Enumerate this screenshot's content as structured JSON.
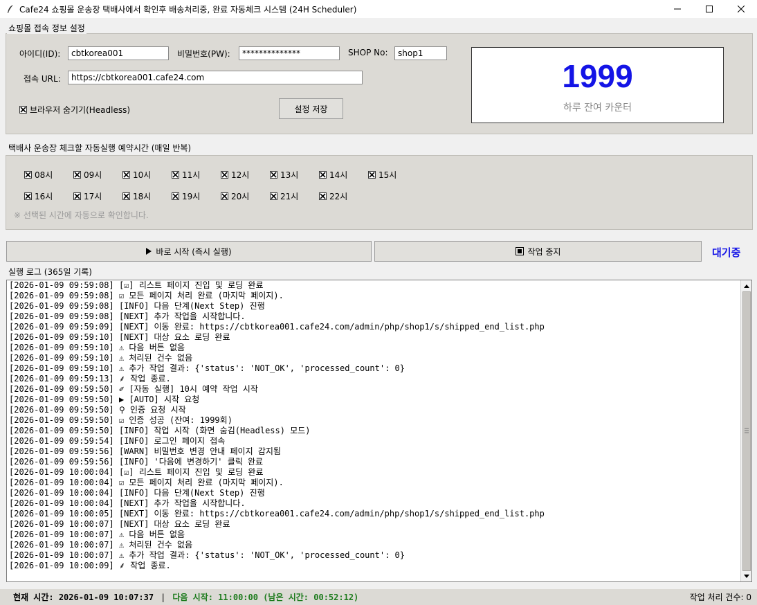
{
  "window": {
    "title": "Cafe24 쇼핑몰 운송장 택배사에서 확인후 배송처리중, 완료 자동체크 시스템 (24H Scheduler)"
  },
  "settings": {
    "group_label": "쇼핑몰 접속 정보 설정",
    "id_label": "아이디(ID):",
    "id_value": "cbtkorea001",
    "pw_label": "비밀번호(PW):",
    "pw_value": "**************",
    "shop_label": "SHOP No:",
    "shop_value": "shop1",
    "url_label": "접속 URL:",
    "url_value": "https://cbtkorea001.cafe24.com",
    "headless_label": "브라우저 숨기기(Headless)",
    "save_label": "설정 저장"
  },
  "counter": {
    "value": "1999",
    "caption": "하루 잔여 카운터"
  },
  "schedule": {
    "group_label": "택배사 운송장 체크할 자동실행 예약시간 (매일 반복)",
    "hours_row1": [
      "08시",
      "09시",
      "10시",
      "11시",
      "12시",
      "13시",
      "14시",
      "15시"
    ],
    "hours_row2": [
      "16시",
      "17시",
      "18시",
      "19시",
      "20시",
      "21시",
      "22시"
    ],
    "hint": "※ 선택된 시간에 자동으로 확인합니다."
  },
  "actions": {
    "start_label": "바로 시작 (즉시 실행)",
    "stop_label": "작업 중지",
    "state": "대기중"
  },
  "log": {
    "group_label": "실행 로그 (365일 기록)",
    "lines": [
      "[2026-01-09 09:59:08] [☑] 리스트 페이지 진입 및 로딩 완료",
      "[2026-01-09 09:59:08] ☑ 모든 페이지 처리 완료 (마지막 페이지).",
      "[2026-01-09 09:59:08] [INFO] 다음 단계(Next Step) 진행",
      "[2026-01-09 09:59:08] [NEXT] 추가 작업을 시작합니다.",
      "[2026-01-09 09:59:09] [NEXT] 이동 완료: https://cbtkorea001.cafe24.com/admin/php/shop1/s/shipped_end_list.php",
      "[2026-01-09 09:59:10] [NEXT] 대상 요소 로딩 완료",
      "[2026-01-09 09:59:10] ⚠ 다음 버튼 없음",
      "[2026-01-09 09:59:10] ⚠ 처리된 건수 없음",
      "[2026-01-09 09:59:10] ⚠ 추가 작업 결과: {'status': 'NOT_OK', 'processed_count': 0}",
      "[2026-01-09 09:59:13] ⸙ 작업 종료.",
      "[2026-01-09 09:59:50] ✐ [자동 실행] 10시 예약 작업 시작",
      "[2026-01-09 09:59:50] ▶ [AUTO] 시작 요청",
      "[2026-01-09 09:59:50] ⚲ 인증 요청 시작",
      "[2026-01-09 09:59:50] ☑ 인증 성공 (잔여: 1999회)",
      "[2026-01-09 09:59:50] [INFO] 작업 시작 (화면 숨김(Headless) 모드)",
      "[2026-01-09 09:59:54] [INFO] 로그인 페이지 접속",
      "[2026-01-09 09:59:56] [WARN] 비밀번호 변경 안내 페이지 감지됨",
      "[2026-01-09 09:59:56] [INFO] '다음에 변경하기' 클릭 완료",
      "[2026-01-09 10:00:04] [☑] 리스트 페이지 진입 및 로딩 완료",
      "[2026-01-09 10:00:04] ☑ 모든 페이지 처리 완료 (마지막 페이지).",
      "[2026-01-09 10:00:04] [INFO] 다음 단계(Next Step) 진행",
      "[2026-01-09 10:00:04] [NEXT] 추가 작업을 시작합니다.",
      "[2026-01-09 10:00:05] [NEXT] 이동 완료: https://cbtkorea001.cafe24.com/admin/php/shop1/s/shipped_end_list.php",
      "[2026-01-09 10:00:07] [NEXT] 대상 요소 로딩 완료",
      "[2026-01-09 10:00:07] ⚠ 다음 버튼 없음",
      "[2026-01-09 10:00:07] ⚠ 처리된 건수 없음",
      "[2026-01-09 10:00:07] ⚠ 추가 작업 결과: {'status': 'NOT_OK', 'processed_count': 0}",
      "[2026-01-09 10:00:09] ⸙ 작업 종료."
    ]
  },
  "statusbar": {
    "now": "현재 시간: 2026-01-09 10:07:37",
    "sep": "|",
    "next": "다음 시작: 11:00:00 (남은 시간: 00:52:12)",
    "count": "작업 처리 건수: 0"
  },
  "colors": {
    "accent_blue": "#1414e6",
    "next_green": "#1b7a1b",
    "panel": "#dcdad5"
  }
}
